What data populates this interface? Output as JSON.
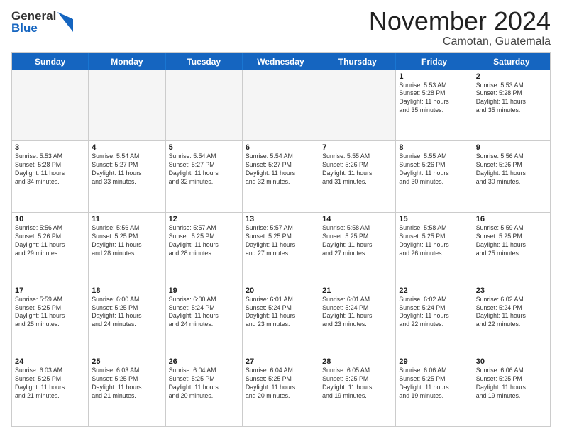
{
  "logo": {
    "general": "General",
    "blue": "Blue"
  },
  "title": "November 2024",
  "location": "Camotan, Guatemala",
  "days_of_week": [
    "Sunday",
    "Monday",
    "Tuesday",
    "Wednesday",
    "Thursday",
    "Friday",
    "Saturday"
  ],
  "weeks": [
    [
      {
        "day": "",
        "info": "",
        "empty": true
      },
      {
        "day": "",
        "info": "",
        "empty": true
      },
      {
        "day": "",
        "info": "",
        "empty": true
      },
      {
        "day": "",
        "info": "",
        "empty": true
      },
      {
        "day": "",
        "info": "",
        "empty": true
      },
      {
        "day": "1",
        "info": "Sunrise: 5:53 AM\nSunset: 5:28 PM\nDaylight: 11 hours\nand 35 minutes."
      },
      {
        "day": "2",
        "info": "Sunrise: 5:53 AM\nSunset: 5:28 PM\nDaylight: 11 hours\nand 35 minutes."
      }
    ],
    [
      {
        "day": "3",
        "info": "Sunrise: 5:53 AM\nSunset: 5:28 PM\nDaylight: 11 hours\nand 34 minutes."
      },
      {
        "day": "4",
        "info": "Sunrise: 5:54 AM\nSunset: 5:27 PM\nDaylight: 11 hours\nand 33 minutes."
      },
      {
        "day": "5",
        "info": "Sunrise: 5:54 AM\nSunset: 5:27 PM\nDaylight: 11 hours\nand 32 minutes."
      },
      {
        "day": "6",
        "info": "Sunrise: 5:54 AM\nSunset: 5:27 PM\nDaylight: 11 hours\nand 32 minutes."
      },
      {
        "day": "7",
        "info": "Sunrise: 5:55 AM\nSunset: 5:26 PM\nDaylight: 11 hours\nand 31 minutes."
      },
      {
        "day": "8",
        "info": "Sunrise: 5:55 AM\nSunset: 5:26 PM\nDaylight: 11 hours\nand 30 minutes."
      },
      {
        "day": "9",
        "info": "Sunrise: 5:56 AM\nSunset: 5:26 PM\nDaylight: 11 hours\nand 30 minutes."
      }
    ],
    [
      {
        "day": "10",
        "info": "Sunrise: 5:56 AM\nSunset: 5:26 PM\nDaylight: 11 hours\nand 29 minutes."
      },
      {
        "day": "11",
        "info": "Sunrise: 5:56 AM\nSunset: 5:25 PM\nDaylight: 11 hours\nand 28 minutes."
      },
      {
        "day": "12",
        "info": "Sunrise: 5:57 AM\nSunset: 5:25 PM\nDaylight: 11 hours\nand 28 minutes."
      },
      {
        "day": "13",
        "info": "Sunrise: 5:57 AM\nSunset: 5:25 PM\nDaylight: 11 hours\nand 27 minutes."
      },
      {
        "day": "14",
        "info": "Sunrise: 5:58 AM\nSunset: 5:25 PM\nDaylight: 11 hours\nand 27 minutes."
      },
      {
        "day": "15",
        "info": "Sunrise: 5:58 AM\nSunset: 5:25 PM\nDaylight: 11 hours\nand 26 minutes."
      },
      {
        "day": "16",
        "info": "Sunrise: 5:59 AM\nSunset: 5:25 PM\nDaylight: 11 hours\nand 25 minutes."
      }
    ],
    [
      {
        "day": "17",
        "info": "Sunrise: 5:59 AM\nSunset: 5:25 PM\nDaylight: 11 hours\nand 25 minutes."
      },
      {
        "day": "18",
        "info": "Sunrise: 6:00 AM\nSunset: 5:25 PM\nDaylight: 11 hours\nand 24 minutes."
      },
      {
        "day": "19",
        "info": "Sunrise: 6:00 AM\nSunset: 5:24 PM\nDaylight: 11 hours\nand 24 minutes."
      },
      {
        "day": "20",
        "info": "Sunrise: 6:01 AM\nSunset: 5:24 PM\nDaylight: 11 hours\nand 23 minutes."
      },
      {
        "day": "21",
        "info": "Sunrise: 6:01 AM\nSunset: 5:24 PM\nDaylight: 11 hours\nand 23 minutes."
      },
      {
        "day": "22",
        "info": "Sunrise: 6:02 AM\nSunset: 5:24 PM\nDaylight: 11 hours\nand 22 minutes."
      },
      {
        "day": "23",
        "info": "Sunrise: 6:02 AM\nSunset: 5:24 PM\nDaylight: 11 hours\nand 22 minutes."
      }
    ],
    [
      {
        "day": "24",
        "info": "Sunrise: 6:03 AM\nSunset: 5:25 PM\nDaylight: 11 hours\nand 21 minutes."
      },
      {
        "day": "25",
        "info": "Sunrise: 6:03 AM\nSunset: 5:25 PM\nDaylight: 11 hours\nand 21 minutes."
      },
      {
        "day": "26",
        "info": "Sunrise: 6:04 AM\nSunset: 5:25 PM\nDaylight: 11 hours\nand 20 minutes."
      },
      {
        "day": "27",
        "info": "Sunrise: 6:04 AM\nSunset: 5:25 PM\nDaylight: 11 hours\nand 20 minutes."
      },
      {
        "day": "28",
        "info": "Sunrise: 6:05 AM\nSunset: 5:25 PM\nDaylight: 11 hours\nand 19 minutes."
      },
      {
        "day": "29",
        "info": "Sunrise: 6:06 AM\nSunset: 5:25 PM\nDaylight: 11 hours\nand 19 minutes."
      },
      {
        "day": "30",
        "info": "Sunrise: 6:06 AM\nSunset: 5:25 PM\nDaylight: 11 hours\nand 19 minutes."
      }
    ]
  ]
}
